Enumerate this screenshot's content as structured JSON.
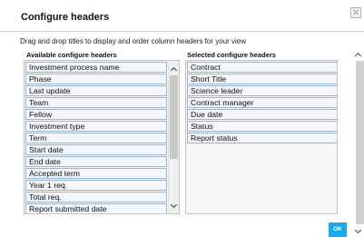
{
  "dialog": {
    "title": "Configure headers",
    "instructions": "Drag and drop titles to display and order column headers for your view",
    "ok_label": "OK"
  },
  "available": {
    "heading": "Available configure headers",
    "items": [
      "Investment process name",
      "Phase",
      "Last update",
      "Team",
      "Fellow",
      "Investment type",
      "Term",
      "Start date",
      "End date",
      "Accepted term",
      "Year 1 req.",
      "Total req.",
      "Report submitted date"
    ]
  },
  "selected": {
    "heading": "Selected configure headers",
    "items": [
      "Contract",
      "Short Title",
      "Science leader",
      "Contract manager",
      "Due date",
      "Status",
      "Report status"
    ]
  },
  "icons": {
    "close": "close-icon",
    "scroll_up": "chevron-up-icon",
    "scroll_down": "chevron-down-icon"
  },
  "colors": {
    "ok_button": "#1ea7e9",
    "item_border": "#9fb4c8"
  }
}
